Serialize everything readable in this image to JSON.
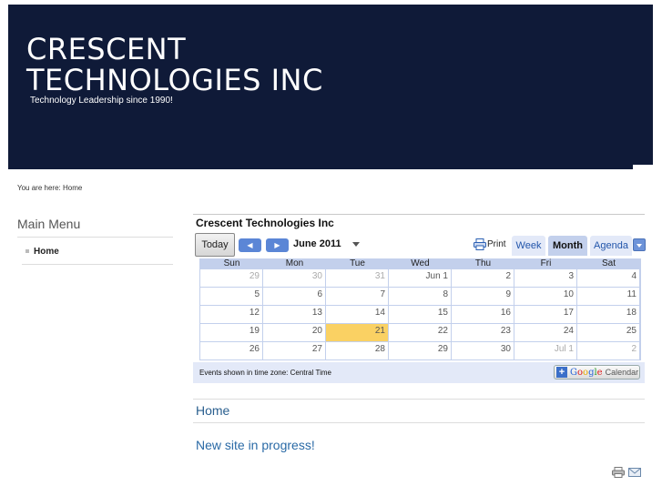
{
  "header": {
    "title_line1": "CRESCENT",
    "title_line2": "TECHNOLOGIES INC",
    "tagline": "Technology Leadership since 1990!"
  },
  "breadcrumb": "You are here: Home",
  "sidebar": {
    "heading": "Main Menu",
    "items": [
      {
        "label": "Home"
      }
    ]
  },
  "calendar": {
    "title": "Crescent Technologies Inc",
    "today_label": "Today",
    "month_label": "June 2011",
    "print_label": "Print",
    "views": [
      "Week",
      "Month",
      "Agenda"
    ],
    "active_view": "Month",
    "days_of_week": [
      "Sun",
      "Mon",
      "Tue",
      "Wed",
      "Thu",
      "Fri",
      "Sat"
    ],
    "weeks": [
      [
        "29",
        "30",
        "31",
        "Jun 1",
        "2",
        "3",
        "4"
      ],
      [
        "5",
        "6",
        "7",
        "8",
        "9",
        "10",
        "11"
      ],
      [
        "12",
        "13",
        "14",
        "15",
        "16",
        "17",
        "18"
      ],
      [
        "19",
        "20",
        "21",
        "22",
        "23",
        "24",
        "25"
      ],
      [
        "26",
        "27",
        "28",
        "29",
        "30",
        "Jul 1",
        "2"
      ]
    ],
    "timezone_text": "Events shown in time zone: Central Time",
    "gcal_word": "Google",
    "gcal_label": "Calendar"
  },
  "content": {
    "page_heading": "Home",
    "article_title": "New site in progress!"
  },
  "colors": {
    "header_bg": "#0f1a38",
    "link": "#2a6aa6",
    "calendar_accent": "#c3d0ec",
    "today_highlight": "#fad163"
  }
}
